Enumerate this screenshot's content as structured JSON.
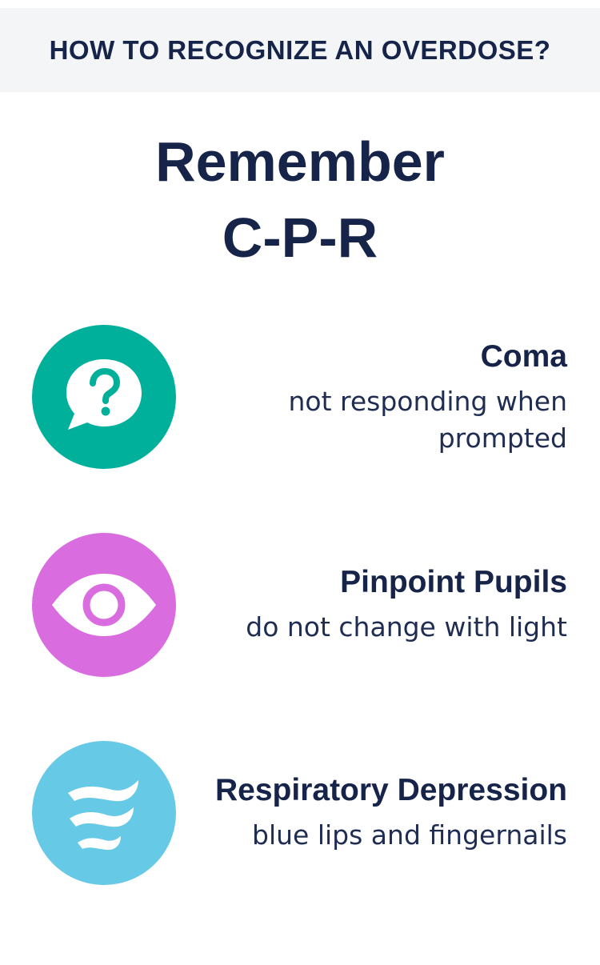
{
  "header": {
    "title": "HOW TO RECOGNIZE AN OVERDOSE?"
  },
  "headline": {
    "line1": "Remember",
    "line2": "C-P-R"
  },
  "items": [
    {
      "icon": "question-bubble-icon",
      "color": "#00b09b",
      "title": "Coma",
      "desc_line1": "not responding when",
      "desc_line2": "prompted"
    },
    {
      "icon": "eye-icon",
      "color": "#d96de0",
      "title": "Pinpoint Pupils",
      "desc_line1": "do not change with light"
    },
    {
      "icon": "wind-icon",
      "color": "#66c9e6",
      "title": "Respiratory Depression",
      "desc_line1": "blue lips and fingernails"
    }
  ]
}
